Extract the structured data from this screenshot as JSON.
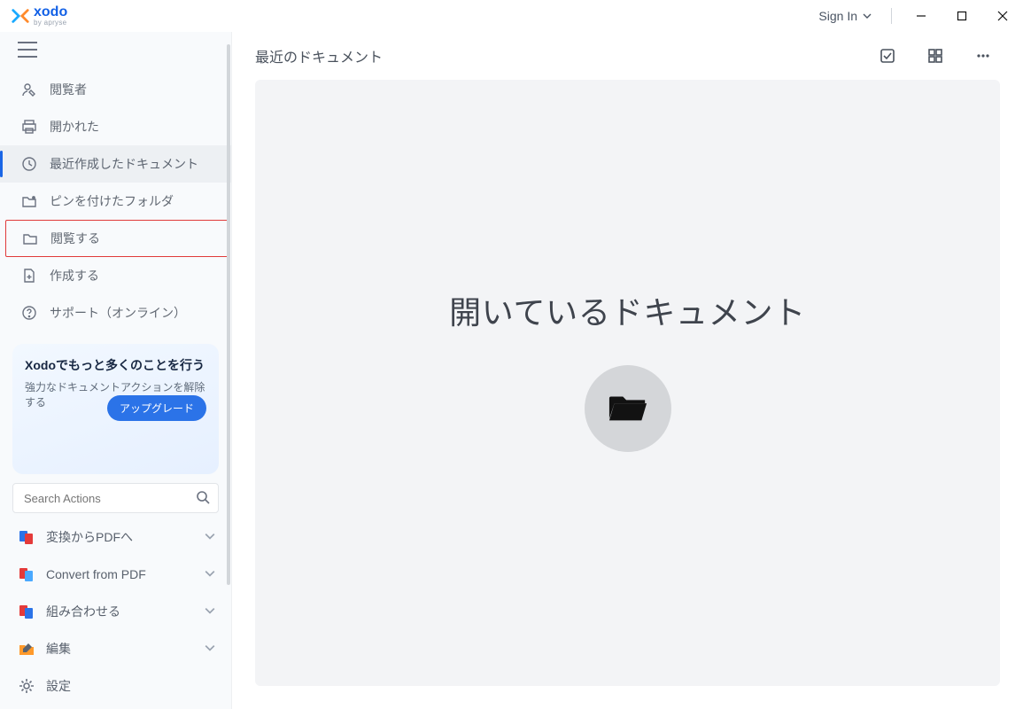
{
  "titlebar": {
    "logo_text": "xodo",
    "logo_sub": "by apryse",
    "signin_label": "Sign In"
  },
  "sidebar": {
    "nav": [
      {
        "key": "viewers",
        "label": "閲覧者"
      },
      {
        "key": "opened",
        "label": "開かれた"
      },
      {
        "key": "recent",
        "label": "最近作成したドキュメント",
        "active": true
      },
      {
        "key": "pinned",
        "label": "ピンを付けたフォルダ"
      },
      {
        "key": "browse",
        "label": "閲覧する",
        "highlighted": true
      },
      {
        "key": "create",
        "label": "作成する"
      },
      {
        "key": "support",
        "label": "サポート（オンライン）"
      }
    ],
    "promo": {
      "title": "Xodoでもっと多くのことを行う",
      "sub": "強力なドキュメントアクションを解除する",
      "button": "アップグレード"
    },
    "search_placeholder": "Search Actions",
    "actions": [
      {
        "key": "convert_to_pdf",
        "label": "変換からPDFへ",
        "icon": "file-dual-blue"
      },
      {
        "key": "convert_from_pdf",
        "label": "Convert from PDF",
        "icon": "file-dual-lightblue"
      },
      {
        "key": "combine",
        "label": "組み合わせる",
        "icon": "file-dual-red"
      },
      {
        "key": "edit",
        "label": "編集",
        "icon": "folder-orange"
      },
      {
        "key": "settings",
        "label": "設定",
        "icon": "gear"
      }
    ]
  },
  "main": {
    "title": "最近のドキュメント",
    "empty_title": "開いているドキュメント"
  }
}
